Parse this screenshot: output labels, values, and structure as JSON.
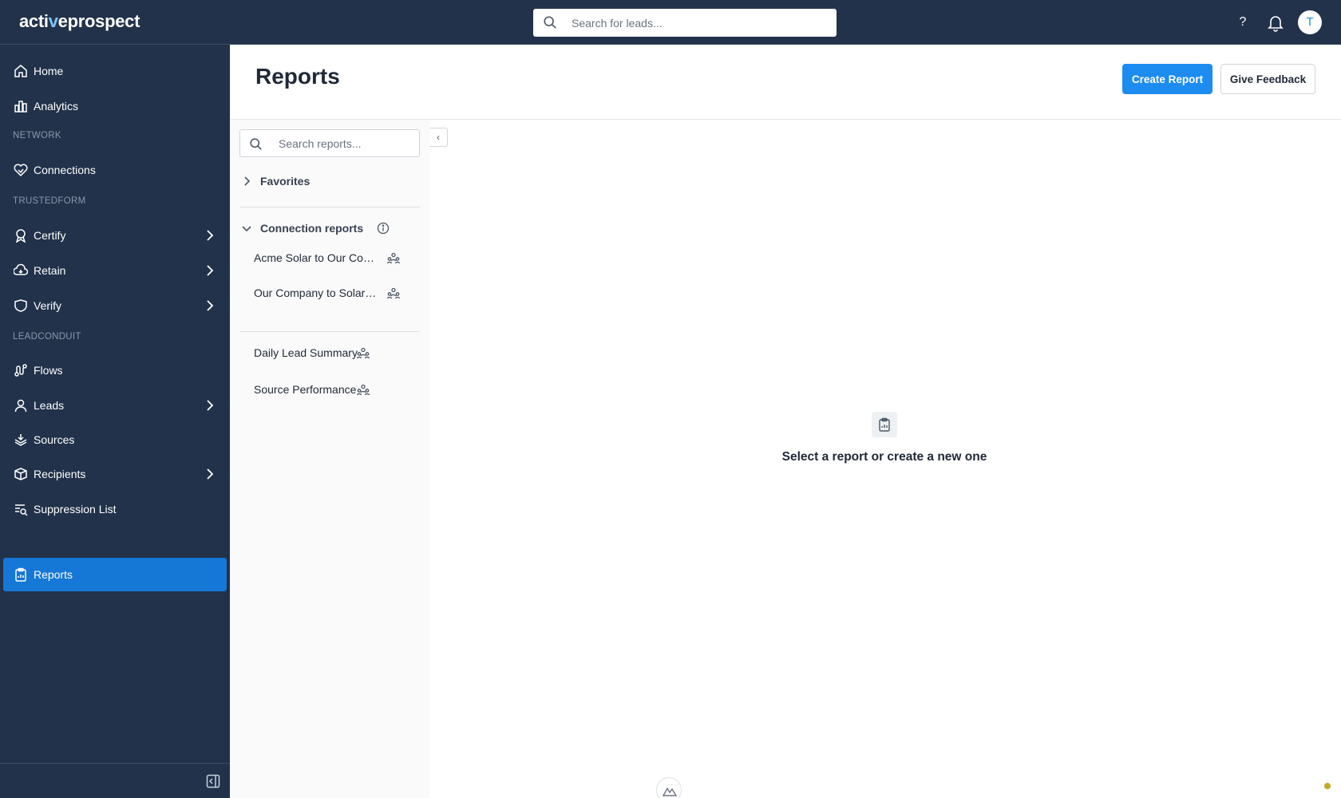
{
  "brand": {
    "logo_pre": "acti",
    "logo_v": "v",
    "logo_post": "eprospect"
  },
  "topbar": {
    "search_placeholder": "Search for leads...",
    "help_label": "?",
    "avatar_initial": "T"
  },
  "sidebar": {
    "items": [
      {
        "label": "Home",
        "icon": "home-icon"
      },
      {
        "label": "Analytics",
        "icon": "analytics-icon"
      },
      {
        "label": "Connections",
        "icon": "connections-icon"
      },
      {
        "label": "Certify",
        "icon": "certify-icon",
        "expandable": true
      },
      {
        "label": "Retain",
        "icon": "retain-icon",
        "expandable": true
      },
      {
        "label": "Verify",
        "icon": "verify-icon",
        "expandable": true
      },
      {
        "label": "Flows",
        "icon": "flows-icon"
      },
      {
        "label": "Leads",
        "icon": "leads-icon",
        "expandable": true
      },
      {
        "label": "Sources",
        "icon": "sources-icon"
      },
      {
        "label": "Recipients",
        "icon": "recipients-icon",
        "expandable": true
      },
      {
        "label": "Suppression List",
        "icon": "suppression-list-icon"
      },
      {
        "label": "Reports",
        "icon": "reports-icon",
        "active": true
      }
    ],
    "sections": {
      "network": "NETWORK",
      "trustedform": "TRUSTEDFORM",
      "leadconduit": "LEADCONDUIT"
    }
  },
  "main": {
    "title": "Reports",
    "create_button": "Create Report",
    "feedback_button": "Give Feedback",
    "empty_state": "Select a report or create a new one"
  },
  "reports_panel": {
    "search_placeholder": "Search reports...",
    "favorites_label": "Favorites",
    "connection_reports_label": "Connection reports",
    "connection_reports": [
      {
        "label": "Acme Solar to Our Company"
      },
      {
        "label": "Our Company to SolarEdge"
      }
    ],
    "reports": [
      {
        "label": "Daily Lead Summary"
      },
      {
        "label": "Source Performance"
      }
    ]
  },
  "colors": {
    "nav_bg": "#21324a",
    "active_item": "#1577d6",
    "primary_button": "#1d8cf0"
  }
}
